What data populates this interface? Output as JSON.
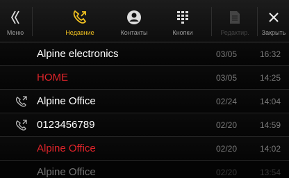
{
  "toolbar": {
    "back": {
      "label": "Меню",
      "icon": "double-chevron-left-icon"
    },
    "recent": {
      "label": "Недавние",
      "icon": "phone-handset-icon",
      "active": true
    },
    "contacts": {
      "label": "Контакты",
      "icon": "person-icon"
    },
    "keypad": {
      "label": "Кнопки",
      "icon": "keypad-icon"
    },
    "edit": {
      "label": "Редактир.",
      "icon": "document-icon",
      "enabled": false
    },
    "close": {
      "label": "Закрыть",
      "icon": "close-icon"
    }
  },
  "colors": {
    "active": "#f0c020",
    "missed": "#e0242a",
    "meta": "#7a7a7a"
  },
  "calls": [
    {
      "name": "Alpine electronics",
      "date": "03/05",
      "time": "16:32",
      "type": "received",
      "icon": ""
    },
    {
      "name": "HOME",
      "date": "03/05",
      "time": "14:25",
      "type": "missed",
      "icon": ""
    },
    {
      "name": "Alpine Office",
      "date": "02/24",
      "time": "14:04",
      "type": "dialed",
      "icon": "outgoing-call-icon"
    },
    {
      "name": "0123456789",
      "date": "02/20",
      "time": "14:59",
      "type": "dialed",
      "icon": "outgoing-call-icon"
    },
    {
      "name": "Alpine Office",
      "date": "02/20",
      "time": "14:02",
      "type": "missed",
      "icon": ""
    },
    {
      "name": "Alpine Office",
      "date": "02/20",
      "time": "13:54",
      "type": "received",
      "icon": ""
    }
  ]
}
